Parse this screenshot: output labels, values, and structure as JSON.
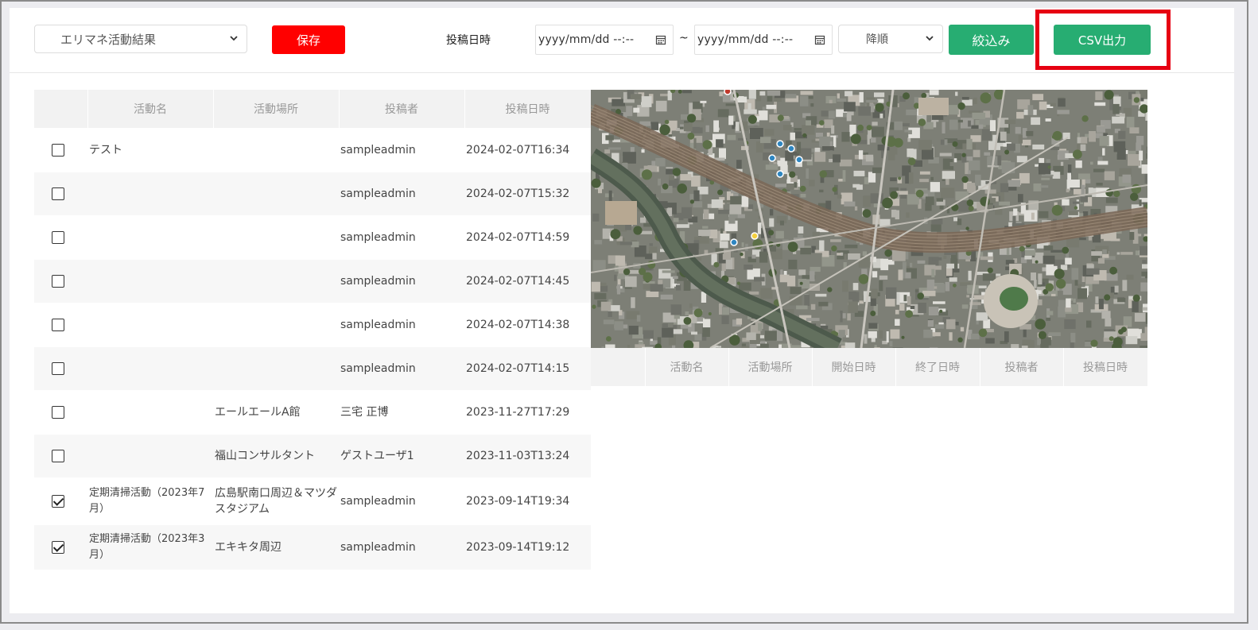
{
  "toolbar": {
    "dataset_select": "エリマネ活動結果",
    "save_label": "保存",
    "post_date_label": "投稿日時",
    "date_from": "yyyy/mm/dd --:--",
    "tilde": "~",
    "date_to": "yyyy/mm/dd --:--",
    "order_select": "降順",
    "filter_label": "絞込み",
    "csv_label": "CSV出力"
  },
  "activity_table": {
    "headers": [
      "",
      "活動名",
      "活動場所",
      "投稿者",
      "投稿日時"
    ],
    "rows": [
      {
        "checked": false,
        "name": "テスト",
        "place": "",
        "poster": "sampleadmin",
        "date": "2024-02-07T16:34"
      },
      {
        "checked": false,
        "name": "",
        "place": "",
        "poster": "sampleadmin",
        "date": "2024-02-07T15:32"
      },
      {
        "checked": false,
        "name": "",
        "place": "",
        "poster": "sampleadmin",
        "date": "2024-02-07T14:59"
      },
      {
        "checked": false,
        "name": "",
        "place": "",
        "poster": "sampleadmin",
        "date": "2024-02-07T14:45"
      },
      {
        "checked": false,
        "name": "",
        "place": "",
        "poster": "sampleadmin",
        "date": "2024-02-07T14:38"
      },
      {
        "checked": false,
        "name": "",
        "place": "",
        "poster": "sampleadmin",
        "date": "2024-02-07T14:15"
      },
      {
        "checked": false,
        "name": "",
        "place": "エールエールA館",
        "poster": "三宅 正博",
        "date": "2023-11-27T17:29"
      },
      {
        "checked": false,
        "name": "",
        "place": "福山コンサルタント",
        "poster": "ゲストユーザ1",
        "date": "2023-11-03T13:24"
      },
      {
        "checked": true,
        "name": "定期清掃活動（2023年7月）",
        "place": "広島駅南口周辺＆マツダスタジアム",
        "poster": "sampleadmin",
        "date": "2023-09-14T19:34"
      },
      {
        "checked": true,
        "name": "定期清掃活動（2023年3月）",
        "place": "エキキタ周辺",
        "poster": "sampleadmin",
        "date": "2023-09-14T19:12"
      }
    ]
  },
  "detail_table": {
    "headers": [
      "",
      "活動名",
      "活動場所",
      "開始日時",
      "終了日時",
      "投稿者",
      "投稿日時"
    ]
  },
  "colors": {
    "save": "#ff0000",
    "green": "#27ad72",
    "highlight": "#e60012"
  }
}
